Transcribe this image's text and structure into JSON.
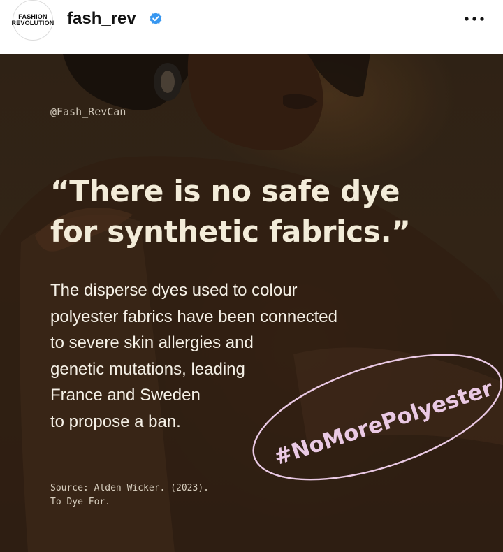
{
  "header": {
    "avatar_line1": "FASHION",
    "avatar_line2": "REVOLUTION",
    "username": "fash_rev",
    "verified_icon": "verified-badge-icon",
    "more_icon": "more-options-icon"
  },
  "post": {
    "handle": "@Fash_RevCan",
    "quote_line1": "“There is no safe dye",
    "quote_line2": "for synthetic fabrics.”",
    "body_lines": [
      "The disperse dyes used to colour",
      "polyester fabrics have been connected",
      "to severe skin allergies and",
      "genetic mutations, leading",
      "France and Sweden",
      "to propose a ban."
    ],
    "hashtag": "#NoMorePolyester",
    "source_line1": "Source: Alden Wicker. (2023).",
    "source_line2": "To Dye For."
  },
  "colors": {
    "background": "#3a2a1a",
    "quote_text": "#f3ecd9",
    "hashtag": "#eac9e4",
    "verified": "#3897f0"
  }
}
